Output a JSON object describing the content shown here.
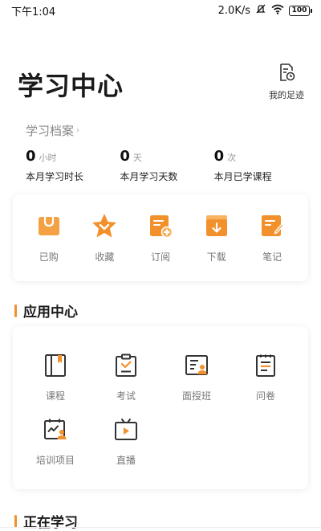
{
  "status_bar": {
    "time": "下午1:04",
    "net_speed": "2.0K/s",
    "battery": "100"
  },
  "header": {
    "title": "学习中心",
    "footprint_label": "我的足迹"
  },
  "archive": {
    "title": "学习档案",
    "stats": [
      {
        "value": "0",
        "unit": "小时",
        "label": "本月学习时长"
      },
      {
        "value": "0",
        "unit": "天",
        "label": "本月学习天数"
      },
      {
        "value": "0",
        "unit": "次",
        "label": "本月已学课程"
      }
    ]
  },
  "quick_actions": [
    {
      "label": "已购",
      "icon": "bag-icon"
    },
    {
      "label": "收藏",
      "icon": "star-icon"
    },
    {
      "label": "订阅",
      "icon": "subscribe-icon"
    },
    {
      "label": "下载",
      "icon": "download-icon"
    },
    {
      "label": "笔记",
      "icon": "note-icon"
    }
  ],
  "app_center": {
    "title": "应用中心",
    "items": [
      {
        "label": "课程",
        "icon": "book-icon"
      },
      {
        "label": "考试",
        "icon": "exam-icon"
      },
      {
        "label": "面授班",
        "icon": "classroom-icon"
      },
      {
        "label": "问卷",
        "icon": "survey-icon"
      },
      {
        "label": "培训项目",
        "icon": "training-icon"
      },
      {
        "label": "直播",
        "icon": "live-tv-icon"
      }
    ]
  },
  "learning_now": {
    "title": "正在学习"
  },
  "colors": {
    "accent": "#f2912b",
    "accent_light": "#f7b463",
    "icon_dark": "#333333"
  }
}
